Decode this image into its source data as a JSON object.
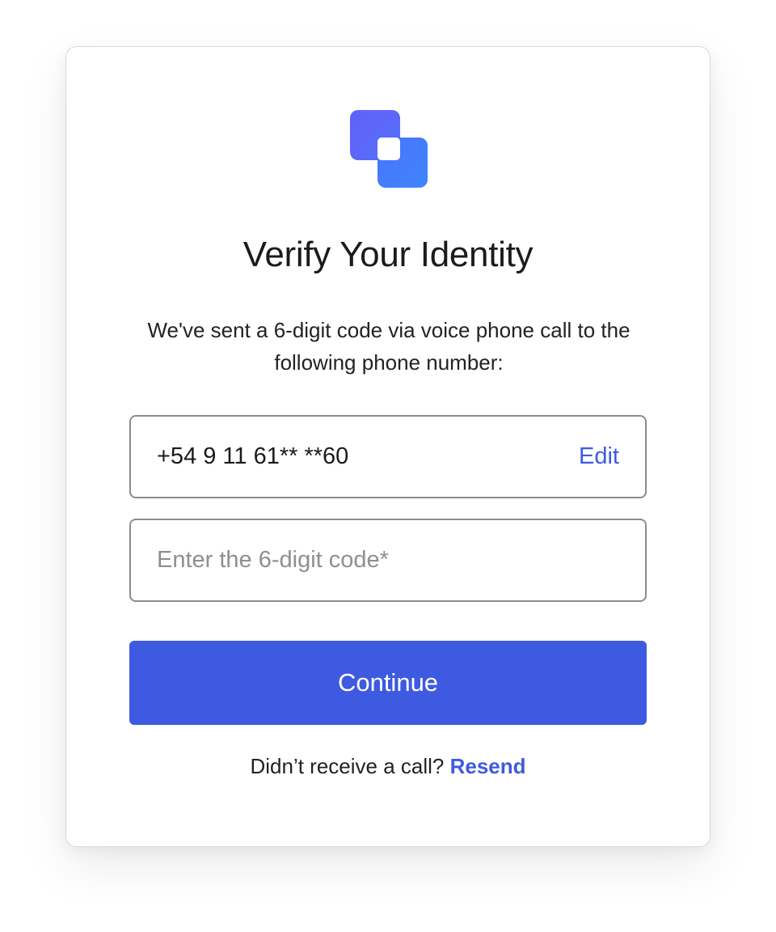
{
  "logo": {
    "icon": "overlapping-squares-logo",
    "color_top": "#5b63f6",
    "color_bottom": "#4480fb"
  },
  "title": "Verify Your Identity",
  "subtitle": "We've sent a 6-digit code via voice phone call to the following phone number:",
  "phone": {
    "value": "+54 9 11 61** **60",
    "edit_label": "Edit"
  },
  "code_input": {
    "value": "",
    "placeholder": "Enter the 6-digit code*"
  },
  "continue_label": "Continue",
  "resend": {
    "prompt": "Didn’t receive a call?",
    "link_label": "Resend"
  },
  "colors": {
    "accent": "#3e5ae0",
    "border": "#8c8c8c",
    "text": "#1b1b1f"
  }
}
